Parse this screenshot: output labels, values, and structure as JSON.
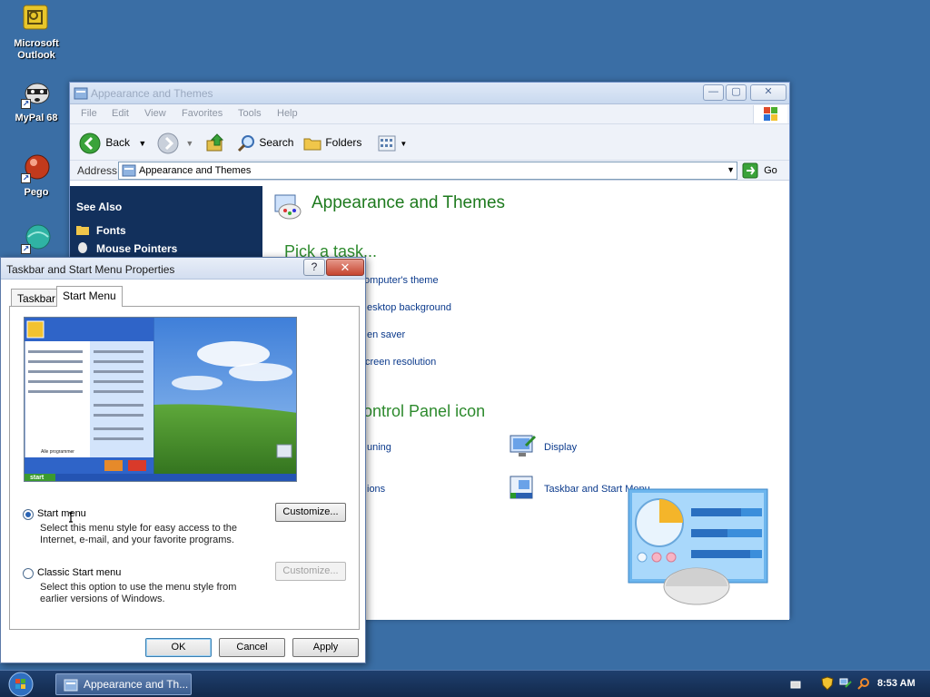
{
  "desktop": {
    "icons": [
      {
        "label": "Microsoft\nOutlook",
        "icon": "outlook-icon"
      },
      {
        "label": "MyPal 68",
        "icon": "raccoon-icon"
      },
      {
        "label": "Pego",
        "icon": "pego-icon"
      },
      {
        "label": "",
        "icon": "globe-icon"
      }
    ],
    "icon_labels": {
      "outlook_line1": "Microsoft",
      "outlook_line2": "Outlook",
      "mypal": "MyPal 68",
      "pego": "Pego"
    }
  },
  "explorer": {
    "title": "Appearance and Themes",
    "menu": [
      "File",
      "Edit",
      "View",
      "Favorites",
      "Tools",
      "Help"
    ],
    "toolbar": {
      "back": "Back",
      "search": "Search",
      "folders": "Folders"
    },
    "address": {
      "label": "Address",
      "value": "Appearance and Themes",
      "go": "Go"
    },
    "see_also": {
      "header": "See Also",
      "links": [
        "Fonts",
        "Mouse Pointers"
      ]
    },
    "main": {
      "title": "Appearance and Themes",
      "pick_task": "Pick a task...",
      "tasks": [
        "omputer's theme",
        "esktop background",
        "en saver",
        "creen resolution"
      ],
      "pick_icon": "ontrol Panel icon",
      "icons": [
        {
          "label": "uning",
          "partial": true
        },
        {
          "label": "Display"
        },
        {
          "label": "ions",
          "partial": true
        },
        {
          "label": "Taskbar and Start Menu"
        }
      ]
    },
    "colors": {
      "left_pane": "#12305c",
      "green_heading": "#1e7a1e",
      "link": "#0b3a8c"
    }
  },
  "dialog": {
    "title": "Taskbar and Start Menu Properties",
    "help": "?",
    "close": "✕",
    "tabs": [
      "Taskbar",
      "Start Menu"
    ],
    "active_tab": "Start Menu",
    "preview": {
      "start_label": "start",
      "all_programs": "Alle programmer"
    },
    "options": [
      {
        "label": "Start menu",
        "desc_line1": "Select this menu style for easy access to the",
        "desc_line2": "Internet, e-mail, and your favorite programs.",
        "button": "Customize...",
        "selected": true
      },
      {
        "label": "Classic Start menu",
        "desc_line1": "Select this option to use the menu style from",
        "desc_line2": "earlier versions of Windows.",
        "button": "Customize...",
        "selected": false
      }
    ],
    "buttons": {
      "ok": "OK",
      "cancel": "Cancel",
      "apply": "Apply"
    }
  },
  "taskbar": {
    "task": "Appearance and Th...",
    "clock": "8:53 AM"
  }
}
